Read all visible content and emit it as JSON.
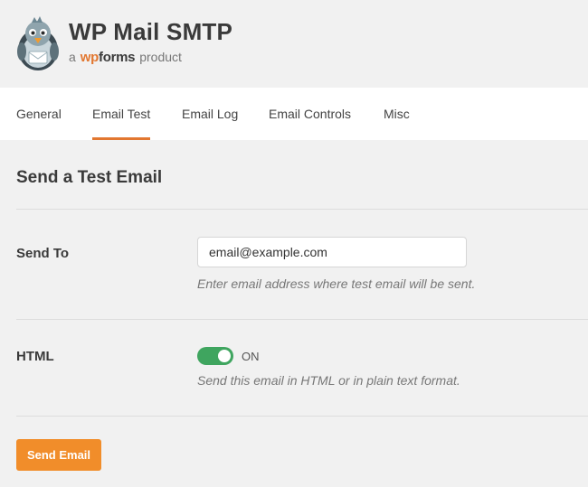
{
  "app": {
    "title": "WP Mail SMTP",
    "tagline_prefix": "a",
    "brand_first": "wp",
    "brand_second": "forms",
    "tagline_suffix": "product",
    "logo_icon": "pigeon-logo-icon"
  },
  "tabs": [
    {
      "label": "General",
      "active": false
    },
    {
      "label": "Email Test",
      "active": true
    },
    {
      "label": "Email Log",
      "active": false
    },
    {
      "label": "Email Controls",
      "active": false
    },
    {
      "label": "Misc",
      "active": false
    }
  ],
  "section": {
    "title": "Send a Test Email"
  },
  "send_to": {
    "label": "Send To",
    "value": "email@example.com",
    "hint": "Enter email address where test email will be sent."
  },
  "html_option": {
    "label": "HTML",
    "state_label": "ON",
    "enabled": true,
    "hint": "Send this email in HTML or in plain text format."
  },
  "actions": {
    "send_label": "Send Email"
  },
  "colors": {
    "accent": "#e27730",
    "button": "#f18d2a",
    "toggle_on": "#3fa55f",
    "background": "#f1f1f1"
  }
}
